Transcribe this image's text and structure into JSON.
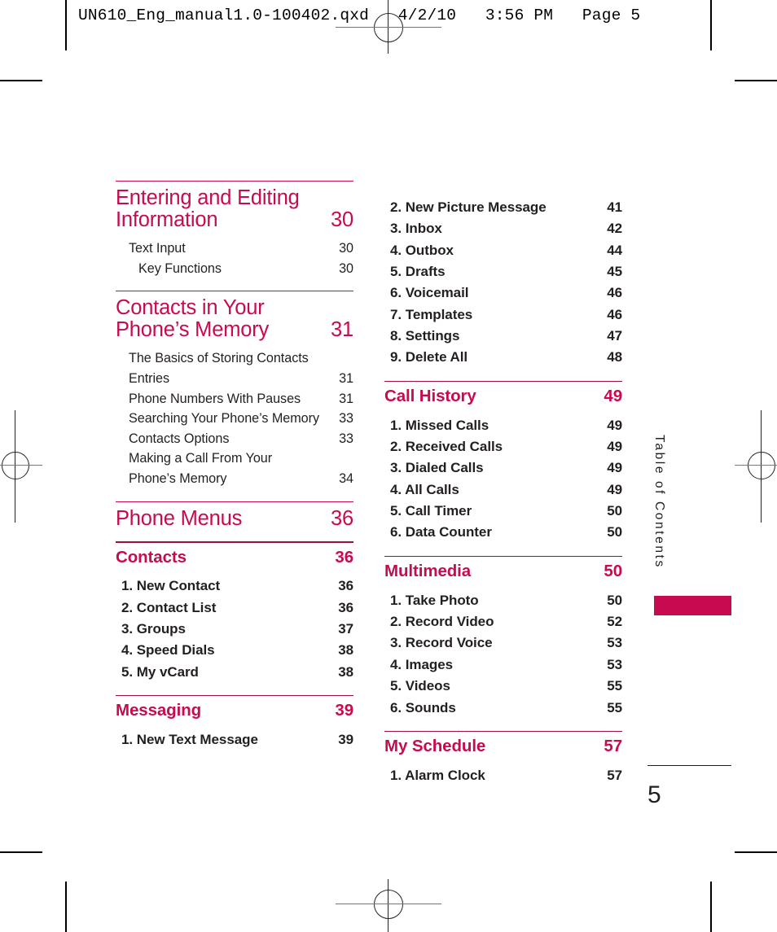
{
  "prepress": {
    "slug": "UN610_Eng_manual1.0-100402.qxd   4/2/10   3:56 PM   Page 5"
  },
  "side_tab": {
    "label": "Table of Contents"
  },
  "folio": {
    "page_number": "5"
  },
  "colors": {
    "accent": "#C80A50",
    "text": "#231f20"
  },
  "toc": {
    "left_column": [
      {
        "type": "major",
        "title": "Entering and Editing Information",
        "page": "30",
        "rule": "thin",
        "children": [
          {
            "type": "entry",
            "level": 1,
            "title": "Text Input",
            "page": "30"
          },
          {
            "type": "entry",
            "level": 2,
            "title": "Key Functions",
            "page": "30"
          }
        ]
      },
      {
        "type": "major",
        "title": "Contacts in Your Phone’s Memory",
        "page": "31",
        "rule": "thin",
        "children": [
          {
            "type": "entry",
            "level": 1,
            "wrap": true,
            "title": "The Basics of Storing Contacts Entries",
            "page": "31"
          },
          {
            "type": "entry",
            "level": 1,
            "title": "Phone Numbers With Pauses",
            "page": "31"
          },
          {
            "type": "entry",
            "level": 1,
            "title": "Searching Your Phone’s Memory",
            "page": "33"
          },
          {
            "type": "entry",
            "level": 1,
            "title": "Contacts Options",
            "page": "33"
          },
          {
            "type": "entry",
            "level": 1,
            "wrap": true,
            "title": "Making a Call From Your Phone’s Memory",
            "page": "34"
          }
        ]
      },
      {
        "type": "major",
        "title": "Phone Menus",
        "page": "36",
        "rule": "thin",
        "children": []
      },
      {
        "type": "sub",
        "title": "Contacts",
        "page": "36",
        "rule": "dark",
        "children": [
          {
            "type": "entry",
            "numbered": true,
            "title": "1. New Contact",
            "page": "36"
          },
          {
            "type": "entry",
            "numbered": true,
            "title": "2. Contact List",
            "page": "36"
          },
          {
            "type": "entry",
            "numbered": true,
            "title": "3. Groups",
            "page": "37"
          },
          {
            "type": "entry",
            "numbered": true,
            "title": "4. Speed Dials",
            "page": "38"
          },
          {
            "type": "entry",
            "numbered": true,
            "title": "5. My vCard",
            "page": "38"
          }
        ]
      },
      {
        "type": "sub",
        "title": "Messaging",
        "page": "39",
        "rule": "dark",
        "children": [
          {
            "type": "entry",
            "numbered": true,
            "title": "1. New Text Message",
            "page": "39"
          }
        ]
      }
    ],
    "right_column": [
      {
        "type": "continuation",
        "children": [
          {
            "type": "entry",
            "numbered": true,
            "title": "2. New Picture Message",
            "page": "41"
          },
          {
            "type": "entry",
            "numbered": true,
            "title": "3. Inbox",
            "page": "42"
          },
          {
            "type": "entry",
            "numbered": true,
            "title": "4. Outbox",
            "page": "44"
          },
          {
            "type": "entry",
            "numbered": true,
            "title": "5. Drafts",
            "page": "45"
          },
          {
            "type": "entry",
            "numbered": true,
            "title": "6. Voicemail",
            "page": "46"
          },
          {
            "type": "entry",
            "numbered": true,
            "title": "7. Templates",
            "page": "46"
          },
          {
            "type": "entry",
            "numbered": true,
            "title": "8. Settings",
            "page": "47"
          },
          {
            "type": "entry",
            "numbered": true,
            "title": "9. Delete All",
            "page": "48"
          }
        ]
      },
      {
        "type": "sub",
        "title": "Call History",
        "page": "49",
        "rule": "dark",
        "children": [
          {
            "type": "entry",
            "numbered": true,
            "title": "1. Missed Calls",
            "page": "49"
          },
          {
            "type": "entry",
            "numbered": true,
            "title": "2. Received Calls",
            "page": "49"
          },
          {
            "type": "entry",
            "numbered": true,
            "title": "3. Dialed Calls",
            "page": "49"
          },
          {
            "type": "entry",
            "numbered": true,
            "title": "4. All Calls",
            "page": "49"
          },
          {
            "type": "entry",
            "numbered": true,
            "title": "5. Call Timer",
            "page": "50"
          },
          {
            "type": "entry",
            "numbered": true,
            "title": "6. Data Counter",
            "page": "50"
          }
        ]
      },
      {
        "type": "sub",
        "title": "Multimedia",
        "page": "50",
        "rule": "dark",
        "children": [
          {
            "type": "entry",
            "numbered": true,
            "title": "1. Take Photo",
            "page": "50"
          },
          {
            "type": "entry",
            "numbered": true,
            "title": "2. Record Video",
            "page": "52"
          },
          {
            "type": "entry",
            "numbered": true,
            "title": "3. Record Voice",
            "page": "53"
          },
          {
            "type": "entry",
            "numbered": true,
            "title": "4. Images",
            "page": "53"
          },
          {
            "type": "entry",
            "numbered": true,
            "title": "5. Videos",
            "page": "55"
          },
          {
            "type": "entry",
            "numbered": true,
            "title": "6. Sounds",
            "page": "55"
          }
        ]
      },
      {
        "type": "sub",
        "title": "My Schedule",
        "page": "57",
        "rule": "dark",
        "children": [
          {
            "type": "entry",
            "numbered": true,
            "title": "1. Alarm Clock",
            "page": "57"
          }
        ]
      }
    ]
  }
}
